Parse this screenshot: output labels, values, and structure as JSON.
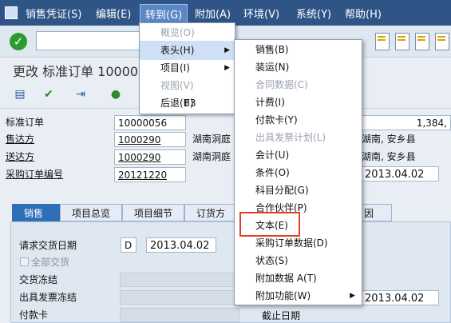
{
  "menubar": {
    "items": [
      "销售凭证(S)",
      "编辑(E)",
      "转到(G)",
      "附加(A)",
      "环境(V)",
      "系统(Y)",
      "帮助(H)"
    ]
  },
  "title": "更改 标准订单 10000",
  "header": {
    "order_label": "标准订单",
    "order_number": "10000056",
    "order_value": "1,384,",
    "soldto_label": "售达方",
    "soldto_number": "1000290",
    "soldto_name": "湖南洞庭",
    "shipto_label": "送达方",
    "shipto_number": "1000290",
    "shipto_name": "湖南洞庭",
    "city_soldto": "湖南, 安乡县",
    "city_shipto": "湖南, 安乡县",
    "po_label": "采购订单编号",
    "po_number": "20121220",
    "po_date": "2013.04.02"
  },
  "tabs": [
    "销售",
    "项目总览",
    "项目细节",
    "订货方",
    "因"
  ],
  "panel": {
    "req_date_label": "请求交货日期",
    "req_date_type": "D",
    "req_date_value": "2013.04.02",
    "complete_label": "全部交货",
    "block_label": "交货冻结",
    "billing_block_label": "出具发票冻结",
    "billing_date": "2013.04.02",
    "card_label": "付款卡",
    "cutoff_label": "截止日期"
  },
  "goto_menu": {
    "items": [
      {
        "label": "概览(O)",
        "disabled": true
      },
      {
        "label": "表头(H)",
        "submenu": true,
        "selected": true
      },
      {
        "label": "项目(I)",
        "submenu": true
      },
      {
        "label": "视图(V)",
        "disabled": true
      },
      {
        "label": "后退(B)",
        "shortcut": "F3"
      }
    ]
  },
  "header_menu": {
    "items": [
      {
        "label": "销售(B)"
      },
      {
        "label": "装运(N)"
      },
      {
        "label": "合同数据(C)",
        "disabled": true
      },
      {
        "label": "计费(I)"
      },
      {
        "label": "付款卡(Y)"
      },
      {
        "label": "出具发票计划(L)",
        "disabled": true
      },
      {
        "label": "会计(U)"
      },
      {
        "label": "条件(O)"
      },
      {
        "label": "科目分配(G)"
      },
      {
        "label": "合作伙伴(P)"
      },
      {
        "label": "文本(E)",
        "highlighted": true
      },
      {
        "label": "采购订单数据(D)"
      },
      {
        "label": "状态(S)"
      },
      {
        "label": "附加数据 A(T)"
      },
      {
        "label": "附加功能(W)",
        "submenu": true
      }
    ]
  },
  "colors": {
    "menubar": "#2f5587",
    "highlight_box": "#e0402a",
    "active_tab": "#2f6fb5"
  }
}
